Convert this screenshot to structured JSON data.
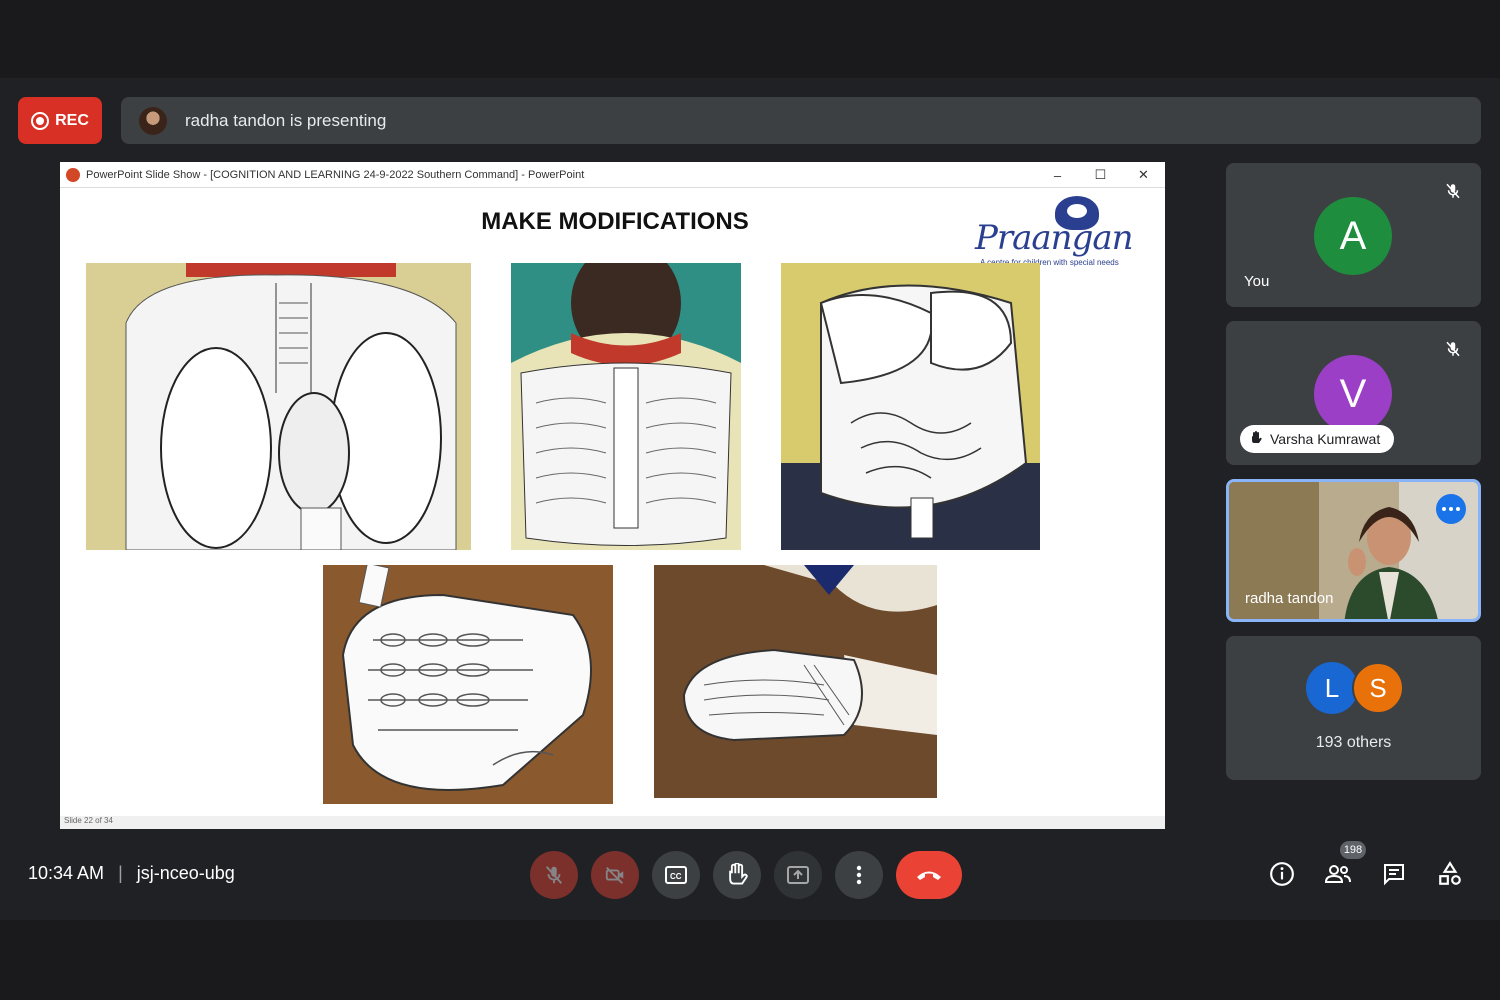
{
  "recording": {
    "label": "REC"
  },
  "presenting_bar": {
    "text": "radha tandon is presenting"
  },
  "shared_window": {
    "title": "PowerPoint Slide Show - [COGNITION AND LEARNING  24-9-2022 Southern Command] - PowerPoint",
    "controls": [
      "–",
      "☐",
      "✕"
    ],
    "slide_title": "MAKE MODIFICATIONS",
    "logo": {
      "name": "Praangan",
      "tagline": "A centre for children with special needs"
    },
    "slide_status": "Slide 22 of 34"
  },
  "participants": [
    {
      "name": "You",
      "initial": "A",
      "color": "#1e8e3e",
      "muted": true
    },
    {
      "name": "Varsha Kumrawat",
      "initial": "V",
      "color": "#9c3fc7",
      "muted": true
    },
    {
      "name": "radha tandon",
      "video": true
    },
    {
      "name": "193 others",
      "initials": [
        "L",
        "S"
      ],
      "colors": [
        "#1967d2",
        "#e8710a"
      ]
    }
  ],
  "bottom_bar": {
    "time": "10:34 AM",
    "meeting_code": "jsj-nceo-ubg",
    "controls": [
      "mic-off",
      "camera-off",
      "captions",
      "raise-hand",
      "present",
      "more",
      "leave-call"
    ],
    "people_count": "198"
  }
}
